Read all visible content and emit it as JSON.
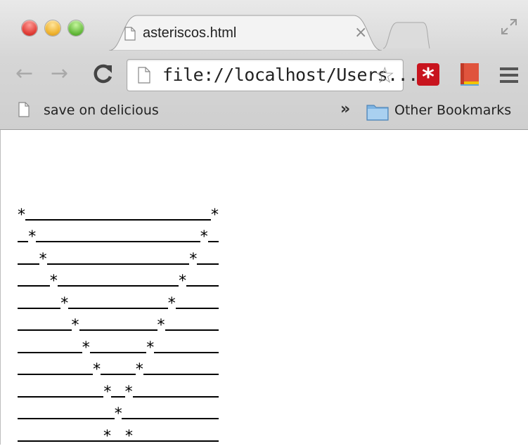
{
  "window": {
    "tab": {
      "title": "asteriscos.html",
      "close": "×"
    }
  },
  "toolbar": {
    "back": "←",
    "forward": "→",
    "url": "file://localhost/Users...",
    "star": "☆",
    "lastpass": "*"
  },
  "bookmarks": {
    "item": "save on delicious",
    "overflow": "»",
    "folder": "Other Bookmarks"
  },
  "page": {
    "pattern_rows": 11,
    "asterisk": "*"
  }
}
